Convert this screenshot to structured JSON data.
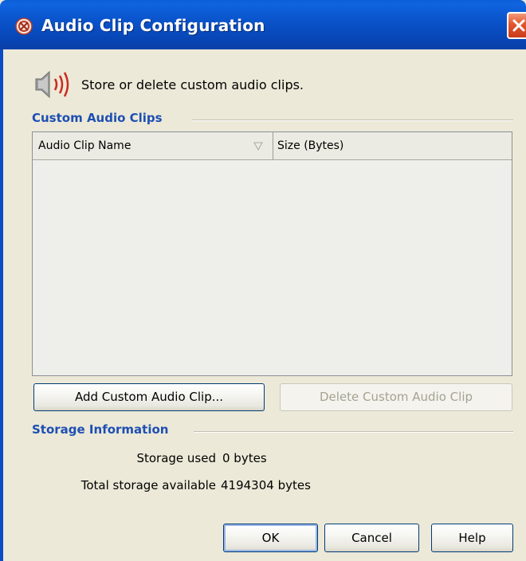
{
  "window": {
    "title": "Audio Clip Configuration",
    "close_icon": "close-icon"
  },
  "header": {
    "icon": "speaker-icon",
    "text": "Store or delete custom audio clips."
  },
  "custom_clips": {
    "heading": "Custom Audio Clips",
    "table": {
      "columns": [
        "Audio Clip Name",
        "Size (Bytes)"
      ],
      "sort_column": "Audio Clip Name",
      "rows": []
    },
    "add_button": "Add Custom Audio Clip...",
    "delete_button": "Delete Custom Audio Clip",
    "delete_enabled": false
  },
  "storage": {
    "heading": "Storage Information",
    "used_label": "Storage used",
    "used_value": "0 bytes",
    "total_label": "Total storage available",
    "total_value": "4194304 bytes"
  },
  "footer": {
    "ok": "OK",
    "cancel": "Cancel",
    "help": "Help"
  },
  "colors": {
    "titlebar": "#0a54cc",
    "heading": "#1d4fb3",
    "dialog_bg": "#ece9d8"
  }
}
